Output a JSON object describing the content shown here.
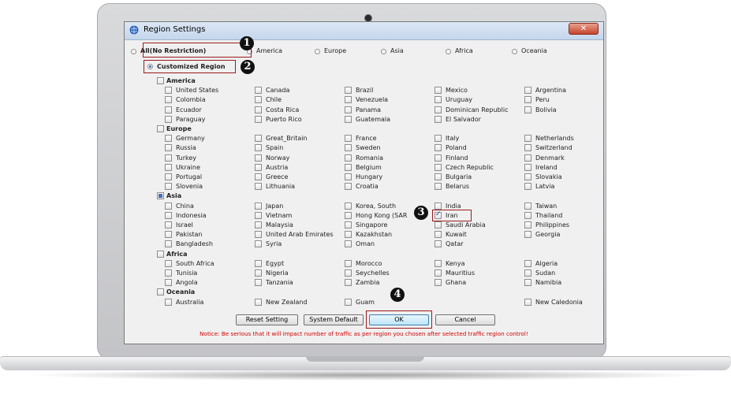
{
  "window": {
    "title": "Region Settings",
    "close_glyph": "✕"
  },
  "modes": [
    {
      "label": "All(No Restriction)",
      "selected": false,
      "highlight": true
    },
    {
      "label": "America",
      "selected": false
    },
    {
      "label": "Europe",
      "selected": false
    },
    {
      "label": "Asia",
      "selected": false
    },
    {
      "label": "Africa",
      "selected": false
    },
    {
      "label": "Oceania",
      "selected": false
    }
  ],
  "customized": {
    "label": "Customized Region",
    "selected": true
  },
  "regions": [
    {
      "name": "America",
      "state": "unchecked",
      "countries": [
        {
          "name": "United States",
          "checked": false
        },
        {
          "name": "Canada",
          "checked": false
        },
        {
          "name": "Brazil",
          "checked": false
        },
        {
          "name": "Mexico",
          "checked": false
        },
        {
          "name": "Argentina",
          "checked": false
        },
        {
          "name": "Colombia",
          "checked": false
        },
        {
          "name": "Chile",
          "checked": false
        },
        {
          "name": "Venezuela",
          "checked": false
        },
        {
          "name": "Uruguay",
          "checked": false
        },
        {
          "name": "Peru",
          "checked": false
        },
        {
          "name": "Ecuador",
          "checked": false
        },
        {
          "name": "Costa Rica",
          "checked": false
        },
        {
          "name": "Panama",
          "checked": false
        },
        {
          "name": "Dominican Republic",
          "checked": false
        },
        {
          "name": "Bolivia",
          "checked": false
        },
        {
          "name": "Paraguay",
          "checked": false
        },
        {
          "name": "Puerto Rico",
          "checked": false
        },
        {
          "name": "Guatemala",
          "checked": false
        },
        {
          "name": "El Salvador",
          "checked": false
        }
      ]
    },
    {
      "name": "Europe",
      "state": "unchecked",
      "countries": [
        {
          "name": "Germany",
          "checked": false
        },
        {
          "name": "Great_Britain",
          "checked": false
        },
        {
          "name": "France",
          "checked": false
        },
        {
          "name": "Italy",
          "checked": false
        },
        {
          "name": "Netherlands",
          "checked": false
        },
        {
          "name": "Russia",
          "checked": false
        },
        {
          "name": "Spain",
          "checked": false
        },
        {
          "name": "Sweden",
          "checked": false
        },
        {
          "name": "Poland",
          "checked": false
        },
        {
          "name": "Switzerland",
          "checked": false
        },
        {
          "name": "Turkey",
          "checked": false
        },
        {
          "name": "Norway",
          "checked": false
        },
        {
          "name": "Romania",
          "checked": false
        },
        {
          "name": "Finland",
          "checked": false
        },
        {
          "name": "Denmark",
          "checked": false
        },
        {
          "name": "Ukraine",
          "checked": false
        },
        {
          "name": "Austria",
          "checked": false
        },
        {
          "name": "Belgium",
          "checked": false
        },
        {
          "name": "Czech Republic",
          "checked": false
        },
        {
          "name": "Ireland",
          "checked": false
        },
        {
          "name": "Portugal",
          "checked": false
        },
        {
          "name": "Greece",
          "checked": false
        },
        {
          "name": "Hungary",
          "checked": false
        },
        {
          "name": "Bulgaria",
          "checked": false
        },
        {
          "name": "Slovakia",
          "checked": false
        },
        {
          "name": "Slovenia",
          "checked": false
        },
        {
          "name": "Lithuania",
          "checked": false
        },
        {
          "name": "Croatia",
          "checked": false
        },
        {
          "name": "Belarus",
          "checked": false
        },
        {
          "name": "Latvia",
          "checked": false
        }
      ]
    },
    {
      "name": "Asia",
      "state": "partial",
      "countries": [
        {
          "name": "China",
          "checked": false
        },
        {
          "name": "Japan",
          "checked": false
        },
        {
          "name": "Korea, South",
          "checked": false
        },
        {
          "name": "India",
          "checked": false
        },
        {
          "name": "Taiwan",
          "checked": false
        },
        {
          "name": "Indonesia",
          "checked": false
        },
        {
          "name": "Vietnam",
          "checked": false
        },
        {
          "name": "Hong Kong (SAR",
          "checked": false
        },
        {
          "name": "Iran",
          "checked": true
        },
        {
          "name": "Thailand",
          "checked": false
        },
        {
          "name": "Israel",
          "checked": false
        },
        {
          "name": "Malaysia",
          "checked": false
        },
        {
          "name": "Singapore",
          "checked": false
        },
        {
          "name": "Saudi Arabia",
          "checked": false
        },
        {
          "name": "Philippines",
          "checked": false
        },
        {
          "name": "Pakistan",
          "checked": false
        },
        {
          "name": "United Arab Emirates",
          "checked": false
        },
        {
          "name": "Kazakhstan",
          "checked": false
        },
        {
          "name": "Kuwait",
          "checked": false
        },
        {
          "name": "Georgia",
          "checked": false
        },
        {
          "name": "Bangladesh",
          "checked": false
        },
        {
          "name": "Syria",
          "checked": false
        },
        {
          "name": "Oman",
          "checked": false
        },
        {
          "name": "Qatar",
          "checked": false
        }
      ]
    },
    {
      "name": "Africa",
      "state": "unchecked",
      "countries": [
        {
          "name": "South Africa",
          "checked": false
        },
        {
          "name": "Egypt",
          "checked": false
        },
        {
          "name": "Morocco",
          "checked": false
        },
        {
          "name": "Kenya",
          "checked": false
        },
        {
          "name": "Algeria",
          "checked": false
        },
        {
          "name": "Tunisia",
          "checked": false
        },
        {
          "name": "Nigeria",
          "checked": false
        },
        {
          "name": "Seychelles",
          "checked": false
        },
        {
          "name": "Mauritius",
          "checked": false
        },
        {
          "name": "Sudan",
          "checked": false
        },
        {
          "name": "Angola",
          "checked": false
        },
        {
          "name": "Tanzania",
          "checked": false
        },
        {
          "name": "Zambia",
          "checked": false
        },
        {
          "name": "Ghana",
          "checked": false
        },
        {
          "name": "Namibia",
          "checked": false
        }
      ]
    },
    {
      "name": "Oceania",
      "state": "unchecked",
      "countries": [
        {
          "name": "Australia",
          "checked": false
        },
        {
          "name": "New Zealand",
          "checked": false
        },
        {
          "name": "Guam",
          "checked": false
        },
        {
          "name": "",
          "checked": false,
          "spacer": true
        },
        {
          "name": "New Caledonia",
          "checked": false
        }
      ]
    }
  ],
  "buttons": {
    "reset": "Reset Setting",
    "system_default": "System Default",
    "ok": "OK",
    "cancel": "Cancel"
  },
  "notice": "Notice: Be serious that it will impact number of traffic as per region you chosen after selected traffic region control!",
  "markers": [
    "1",
    "2",
    "3",
    "4"
  ],
  "colors": {
    "highlight": "#9b1b1b",
    "notice": "#d40000",
    "checkbox_accent": "#1d3f8f"
  },
  "icons": {
    "app": "region-globe-icon",
    "close": "close-icon"
  }
}
